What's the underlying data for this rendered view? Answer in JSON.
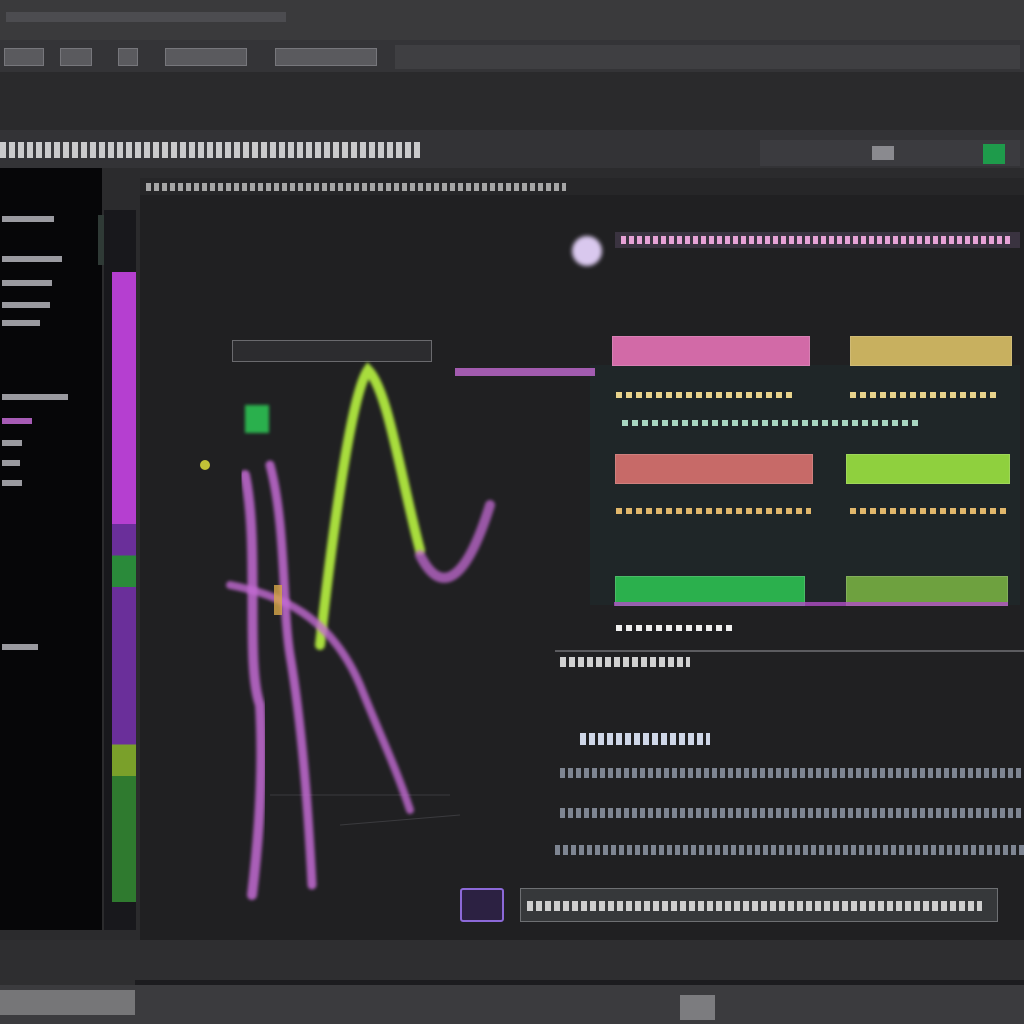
{
  "colors": {
    "magenta": "#c36ad3",
    "lime": "#a8dd3c",
    "green": "#2bb04d",
    "orange": "#d9a84a",
    "cyan": "#5ba8b4"
  },
  "icons": {
    "glow": "glow-dot-icon",
    "panel": "panel-icon"
  }
}
